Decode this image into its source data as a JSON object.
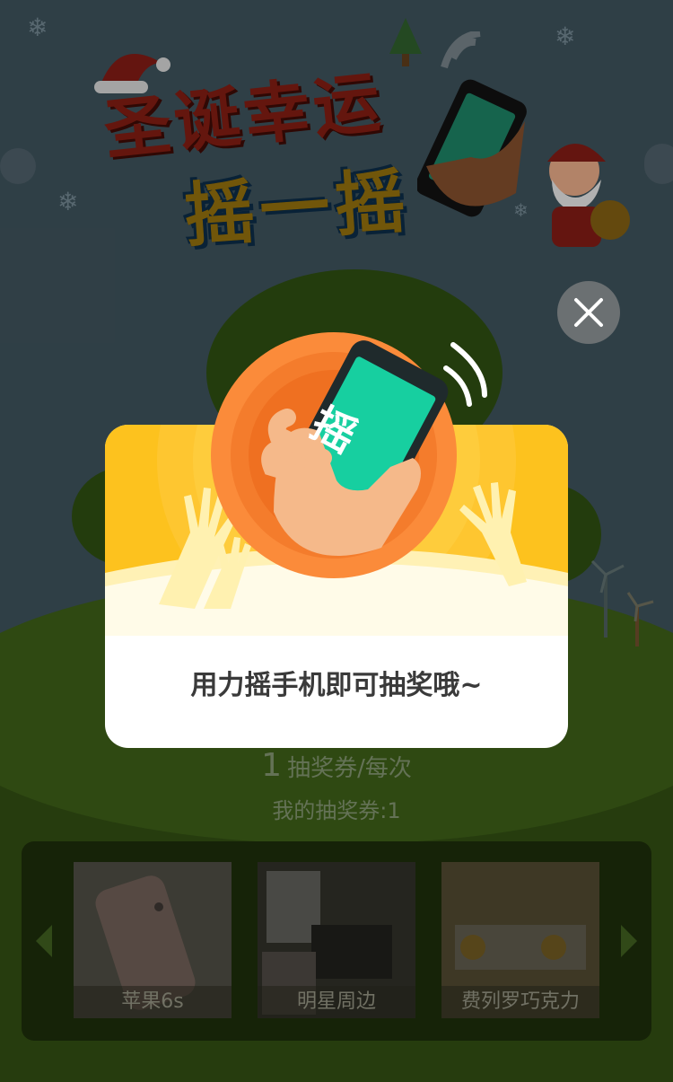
{
  "title": {
    "line1": "圣诞幸运",
    "line2": "摇一摇"
  },
  "modal": {
    "message": "用力摇手机即可抽奖哦~",
    "phone_glyph": "摇",
    "close_icon": "close-icon"
  },
  "cost": {
    "amount": "1",
    "unit": "抽奖券/每次"
  },
  "tickets": {
    "label": "我的抽奖券:1"
  },
  "prizes": [
    {
      "label": "苹果6s"
    },
    {
      "label": "明星周边"
    },
    {
      "label": "费列罗巧克力"
    }
  ],
  "colors": {
    "modal_yellow": "#fdc21e",
    "circle_orange": "#f47c2c",
    "phone_screen": "#17cfa0",
    "close_bg": "#6b7072"
  }
}
